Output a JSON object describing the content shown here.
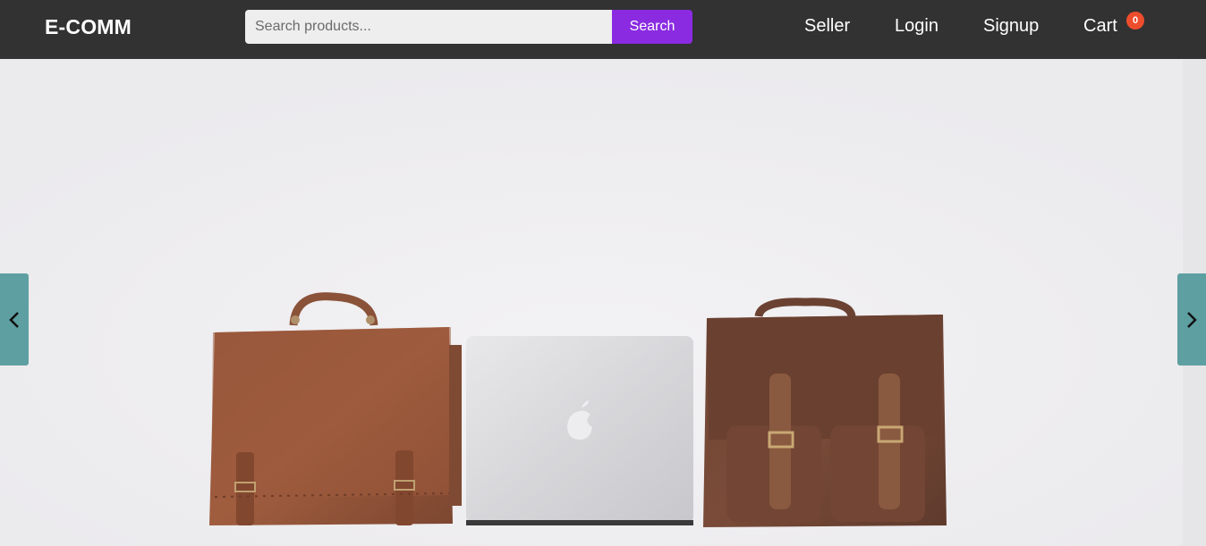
{
  "header": {
    "logo": "E-COMM",
    "search": {
      "placeholder": "Search products...",
      "value": "",
      "button_label": "Search"
    },
    "nav": {
      "seller": "Seller",
      "login": "Login",
      "signup": "Signup",
      "cart": "Cart",
      "cart_count": "0"
    }
  },
  "carousel": {
    "prev_icon": "chevron-left-icon",
    "next_icon": "chevron-right-icon"
  },
  "colors": {
    "navbar": "#323232",
    "accent": "#8a2be2",
    "badge": "#ee4d2d",
    "carousel_button": "#5e9fa1"
  }
}
